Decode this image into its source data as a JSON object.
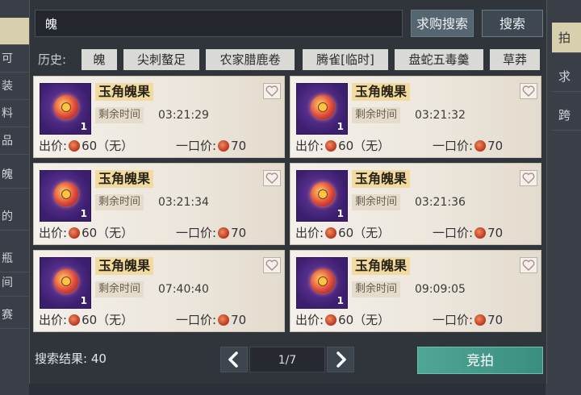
{
  "left_tabs": [
    "",
    "可",
    "装",
    "料",
    "品",
    "魄",
    "的",
    "瓶",
    "间",
    "赛"
  ],
  "right_tabs": [
    "拍",
    "求",
    "跨"
  ],
  "search": {
    "value": "魄",
    "buy_search_label": "求购搜索",
    "search_label": "搜索"
  },
  "history": {
    "label": "历史:",
    "chips": [
      "魄",
      "尖刺螯足",
      "农家腊鹿卷",
      "腾雀[临时]",
      "盘蛇五毒羹",
      "草莽"
    ]
  },
  "listings": [
    {
      "name": "玉角魄果",
      "time_label": "剩余时间",
      "time": "03:21:29",
      "qty": "1",
      "bid_label": "出价:",
      "bid": "60（无）",
      "buyout_label": "一口价:",
      "buyout": "70"
    },
    {
      "name": "玉角魄果",
      "time_label": "剩余时间",
      "time": "03:21:32",
      "qty": "1",
      "bid_label": "出价:",
      "bid": "60（无）",
      "buyout_label": "一口价:",
      "buyout": "70"
    },
    {
      "name": "玉角魄果",
      "time_label": "剩余时间",
      "time": "03:21:34",
      "qty": "1",
      "bid_label": "出价:",
      "bid": "60（无）",
      "buyout_label": "一口价:",
      "buyout": "70"
    },
    {
      "name": "玉角魄果",
      "time_label": "剩余时间",
      "time": "03:21:36",
      "qty": "1",
      "bid_label": "出价:",
      "bid": "60（无）",
      "buyout_label": "一口价:",
      "buyout": "70"
    },
    {
      "name": "玉角魄果",
      "time_label": "剩余时间",
      "time": "07:40:40",
      "qty": "1",
      "bid_label": "出价:",
      "bid": "60（无）",
      "buyout_label": "一口价:",
      "buyout": "70"
    },
    {
      "name": "玉角魄果",
      "time_label": "剩余时间",
      "time": "09:09:05",
      "qty": "1",
      "bid_label": "出价:",
      "bid": "60（无）",
      "buyout_label": "一口价:",
      "buyout": "70"
    }
  ],
  "footer": {
    "result_label": "搜索结果:",
    "result_count": "40",
    "page": "1/7",
    "bid_button": "竞拍"
  },
  "colors": {
    "accent": "#4fa596",
    "name_highlight": "#f1dba0",
    "item_bg": "#3c1e6e"
  },
  "icons": {
    "prev": "chevron-left-icon",
    "next": "chevron-right-icon",
    "favorite": "heart-icon",
    "currency": "coin-icon"
  }
}
